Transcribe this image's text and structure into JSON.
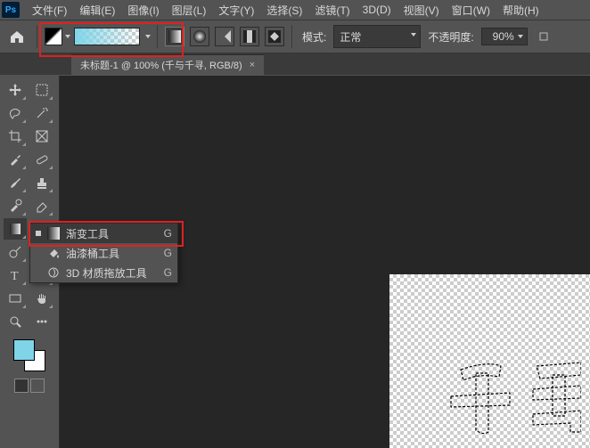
{
  "app": {
    "logo": "Ps"
  },
  "menu": {
    "file": "文件(F)",
    "edit": "编辑(E)",
    "image": "图像(I)",
    "layer": "图层(L)",
    "type": "文字(Y)",
    "select": "选择(S)",
    "filter": "滤镜(T)",
    "threeD": "3D(D)",
    "view": "视图(V)",
    "window": "窗口(W)",
    "help": "帮助(H)"
  },
  "options": {
    "mode_label": "模式:",
    "mode_value": "正常",
    "opacity_label": "不透明度:",
    "opacity_value": "90%"
  },
  "document": {
    "tab_title": "未标题-1 @ 100% (千与千寻, RGB/8)",
    "close": "×"
  },
  "flyout": {
    "gradient": "渐变工具",
    "bucket": "油漆桶工具",
    "drop3d": "3D 材质拖放工具",
    "key_g": "G"
  },
  "canvas": {
    "sample_text": "千与"
  }
}
